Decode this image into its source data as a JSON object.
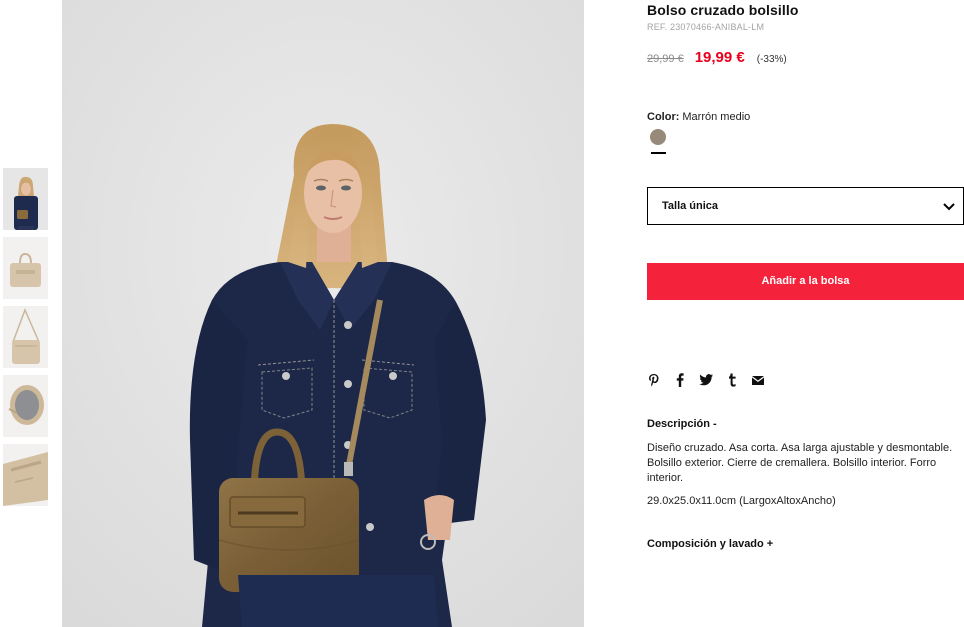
{
  "product": {
    "title": "Bolso cruzado bolsillo",
    "ref": "REF. 23070466-ANIBAL-LM",
    "old_price": "29,99 €",
    "new_price": "19,99 €",
    "discount": "(-33%)"
  },
  "color": {
    "label": "Color:",
    "value": "Marrón medio",
    "swatch_color": "#978a7a"
  },
  "size": {
    "selected": "Talla única"
  },
  "add_to_bag_label": "Añadir a la bolsa",
  "share_icons": [
    "pinterest-icon",
    "facebook-icon",
    "twitter-icon",
    "tumblr-icon",
    "email-icon"
  ],
  "description": {
    "title": "Descripción -",
    "text": "Diseño cruzado. Asa corta. Asa larga ajustable y desmontable. Bolsillo exterior. Cierre de cremallera. Bolsillo interior. Forro interior.",
    "dimensions": "29.0x25.0x11.0cm (LargoxAltoxAncho)"
  },
  "composition_title": "Composición y lavado +",
  "accent_color": "#f4233b",
  "price_color": "#e8001c"
}
